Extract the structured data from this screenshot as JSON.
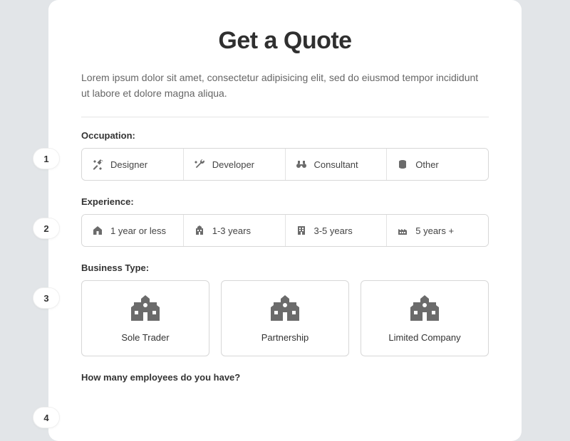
{
  "header": {
    "title": "Get a Quote",
    "intro": "Lorem ipsum dolor sit amet, consectetur adipisicing elit, sed do eiusmod tempor incididunt ut labore et dolore magna aliqua."
  },
  "steps": {
    "s1": "1",
    "s2": "2",
    "s3": "3",
    "s4": "4"
  },
  "occupation": {
    "label": "Occupation:",
    "options": {
      "o1": "Designer",
      "o2": "Developer",
      "o3": "Consultant",
      "o4": "Other"
    }
  },
  "experience": {
    "label": "Experience:",
    "options": {
      "e1": "1 year or less",
      "e2": "1-3 years",
      "e3": "3-5 years",
      "e4": "5 years +"
    }
  },
  "business": {
    "label": "Business Type:",
    "options": {
      "b1": "Sole Trader",
      "b2": "Partnership",
      "b3": "Limited Company"
    }
  },
  "employees": {
    "label": "How many employees do you have?"
  }
}
